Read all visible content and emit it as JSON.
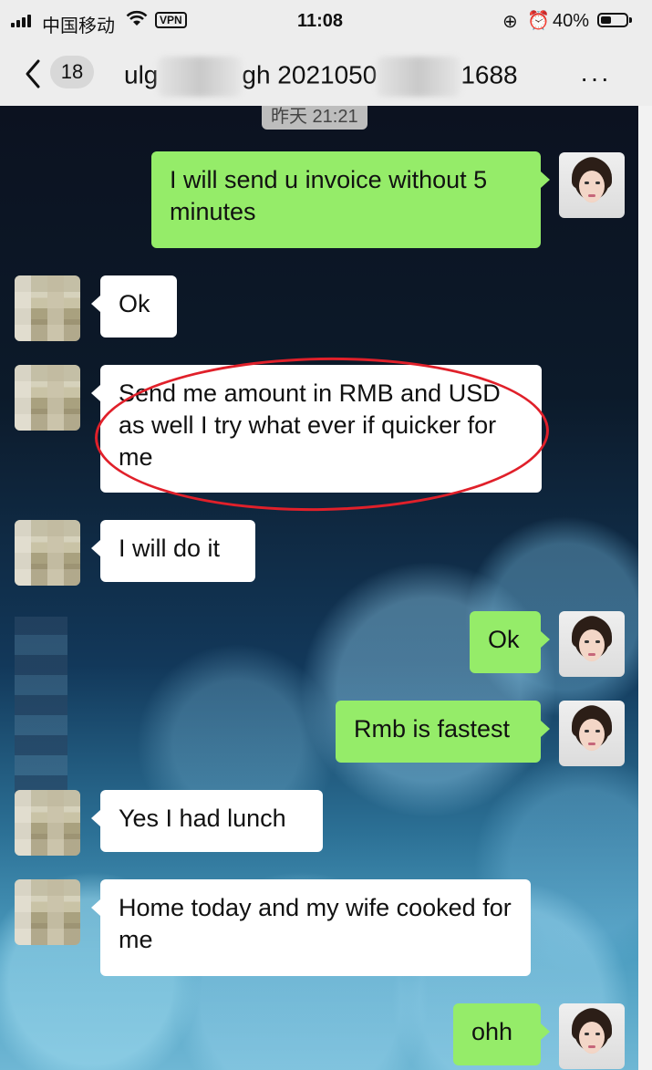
{
  "status_bar": {
    "carrier": "中国移动",
    "vpn": "VPN",
    "time": "11:08",
    "battery": "40%"
  },
  "nav": {
    "unread_count": "18",
    "title_part1": "ulg",
    "title_part2": "gh 2021050",
    "title_part3": "1688",
    "more": "···"
  },
  "chat": {
    "timestamp": "昨天 21:21",
    "messages": [
      {
        "side": "me",
        "text": "I will send u invoice without 5 minutes"
      },
      {
        "side": "them",
        "text": "Ok"
      },
      {
        "side": "them",
        "text": "Send me amount in RMB and USD as well I try what ever if quicker for me"
      },
      {
        "side": "them",
        "text": "I will do it"
      },
      {
        "side": "me",
        "text": "Ok"
      },
      {
        "side": "me",
        "text": "Rmb is fastest"
      },
      {
        "side": "them",
        "text": "Yes I had lunch"
      },
      {
        "side": "them",
        "text": "Home today and my wife cooked for me"
      },
      {
        "side": "me",
        "text": "ohh"
      }
    ]
  },
  "colors": {
    "outgoing_bubble": "#95ec69",
    "incoming_bubble": "#ffffff",
    "highlight_circle": "#e0202a"
  }
}
